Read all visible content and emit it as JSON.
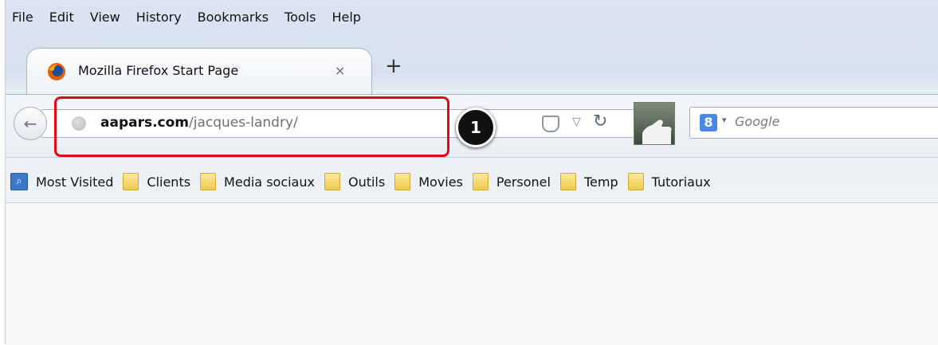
{
  "menu": [
    "File",
    "Edit",
    "View",
    "History",
    "Bookmarks",
    "Tools",
    "Help"
  ],
  "tab": {
    "title": "Mozilla Firefox Start Page",
    "close_symbol": "×"
  },
  "new_tab_symbol": "+",
  "navbar": {
    "url_domain": "aapars.com",
    "url_path": "/jacques-landry/",
    "search_placeholder": "Google",
    "search_engine_glyph": "8"
  },
  "annotation": {
    "callout_number": "1",
    "box_color": "#e30613"
  },
  "bookmarks": [
    "Most Visited",
    "Clients",
    "Media sociaux",
    "Outils",
    "Movies",
    "Personel",
    "Temp",
    "Tutoriaux"
  ],
  "icons": {
    "tab_favicon": "firefox-icon",
    "back": "back-arrow-icon",
    "url_site": "globe-icon",
    "pocket": "pocket-icon",
    "dropdown": "dropdown-arrow-icon",
    "reload": "reload-icon",
    "addon": "addon-icon",
    "search_engine": "google-icon",
    "bookmark_folder": "folder-icon",
    "most_visited": "most-visited-icon"
  }
}
